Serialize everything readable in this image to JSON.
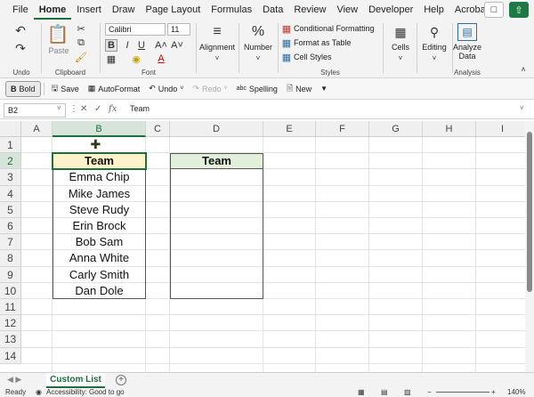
{
  "menu": {
    "tabs": [
      "File",
      "Home",
      "Insert",
      "Draw",
      "Page Layout",
      "Formulas",
      "Data",
      "Review",
      "View",
      "Developer",
      "Help",
      "Acrobat"
    ],
    "active_tab": "Home"
  },
  "ribbon": {
    "undo_label": "Undo",
    "clipboard_label": "Clipboard",
    "paste_label": "Paste",
    "font_name": "Calibri",
    "font_size": "11",
    "font_label": "Font",
    "alignment_label": "Alignment",
    "number_label": "Number",
    "cond_formatting": "Conditional Formatting",
    "format_as_table": "Format as Table",
    "cell_styles": "Cell Styles",
    "styles_label": "Styles",
    "cells_label": "Cells",
    "editing_label": "Editing",
    "analyze_data_1": "Analyze",
    "analyze_data_2": "Data",
    "analysis_label": "Analysis"
  },
  "quick_toolbar": {
    "bold": "Bold",
    "save": "Save",
    "autoformat": "AutoFormat",
    "undo": "Undo",
    "redo": "Redo",
    "spelling": "Spelling",
    "new": "New"
  },
  "formula_bar": {
    "name_box": "B2",
    "formula": "Team"
  },
  "columns": [
    "A",
    "B",
    "C",
    "D",
    "E",
    "F",
    "G",
    "H",
    "I"
  ],
  "rows": [
    "1",
    "2",
    "3",
    "4",
    "5",
    "6",
    "7",
    "8",
    "9",
    "10",
    "11",
    "12",
    "13",
    "14"
  ],
  "table_b": {
    "header": "Team",
    "names": [
      "Emma Chip",
      "Mike James",
      "Steve Rudy",
      "Erin Brock",
      "Bob Sam",
      "Anna White",
      "Carly Smith",
      "Dan Dole"
    ]
  },
  "table_d": {
    "header": "Team"
  },
  "sheet": {
    "tab_name": "Custom List"
  },
  "status": {
    "ready": "Ready",
    "accessibility": "Accessibility: Good to go",
    "zoom": "140%"
  },
  "colors": {
    "accent": "#1e6e3e",
    "header_fill_b": "#fdf2c9",
    "header_fill_d": "#e2efda"
  }
}
